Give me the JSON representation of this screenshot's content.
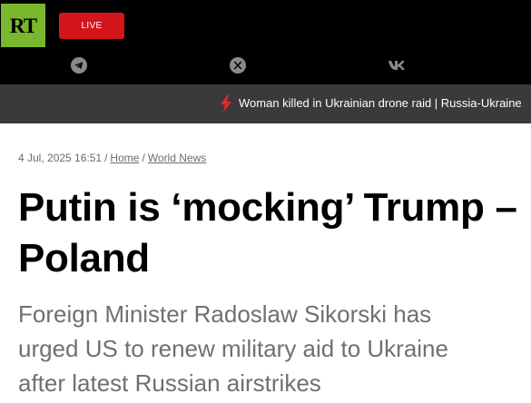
{
  "header": {
    "logo_text": "RT",
    "live_label": "LIVE",
    "social": [
      "telegram-icon",
      "x-icon",
      "vk-icon"
    ],
    "colors": {
      "logo_bg": "#78b72e",
      "live_bg": "#d4151c",
      "bar_bg": "#000000",
      "ticker_bg": "#3a3a3a"
    }
  },
  "ticker": {
    "icon": "lightning-icon",
    "text": "Woman killed in Ukrainian drone raid | Russia-Ukraine"
  },
  "article": {
    "date": "4 Jul, 2025 16:51",
    "breadcrumb": [
      "Home",
      "World News"
    ],
    "title": "Putin is ‘mocking’ Trump – Poland",
    "lead": "Foreign Minister Radoslaw Sikorski has urged US to renew military aid to Ukraine after latest Russian airstrikes"
  }
}
